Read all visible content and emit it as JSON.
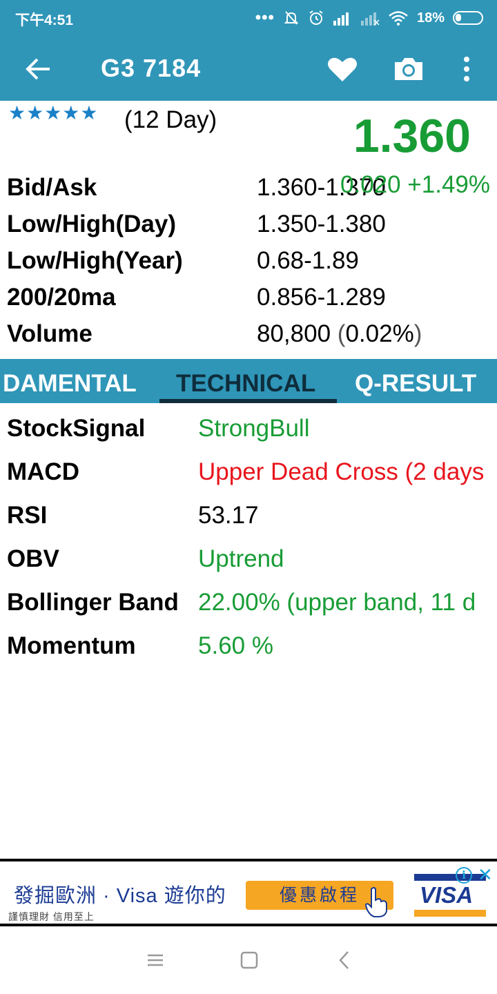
{
  "status_bar": {
    "time": "下午4:51",
    "dots": "•••",
    "battery_percent": "18%",
    "icons": [
      "mute-bell-icon",
      "alarm-icon",
      "signal-icon",
      "signal-no-service-icon",
      "wifi-icon",
      "battery-icon"
    ]
  },
  "app_bar": {
    "title": "G3 7184",
    "icons": [
      "back-arrow-icon",
      "heart-icon",
      "camera-icon",
      "more-vertical-icon"
    ],
    "color": "#2f96b8"
  },
  "rating": {
    "stars": "★★★★★",
    "star_count": 5,
    "period": "(12 Day)"
  },
  "quote": {
    "price": "1.360",
    "change": "0.020 +1.49%",
    "color": "#189c35"
  },
  "info": [
    {
      "label": "Bid/Ask",
      "value": "1.360-1.370"
    },
    {
      "label": "Low/High(Day)",
      "value": "1.350-1.380"
    },
    {
      "label": "Low/High(Year)",
      "value": "0.68-1.89"
    },
    {
      "label": "200/20ma",
      "value": "0.856-1.289"
    },
    {
      "label": "Volume",
      "value": "80,800",
      "pct_open": "(",
      "pct": "0.02%",
      "pct_close": ")"
    }
  ],
  "tabs": [
    {
      "label": "DAMENTAL",
      "active": false
    },
    {
      "label": "TECHNICAL",
      "active": true
    },
    {
      "label": "Q-RESULT",
      "active": false
    }
  ],
  "technical": [
    {
      "label": "StockSignal",
      "value": "StrongBull",
      "color": "#189c35"
    },
    {
      "label": "MACD",
      "value": "Upper Dead Cross (2 days",
      "color": "#e8141c"
    },
    {
      "label": "RSI",
      "value": "53.17",
      "color": "#000000"
    },
    {
      "label": "OBV",
      "value": "Uptrend",
      "color": "#189c35"
    },
    {
      "label": "Bollinger Band",
      "value": "22.00% (upper band, 11 d",
      "color": "#189c35"
    },
    {
      "label": "Momentum",
      "value": "5.60 %",
      "color": "#189c35"
    }
  ],
  "ad": {
    "headline": "發掘歐洲 · Visa 遊你的",
    "subtext": "謹慎理財 信用至上",
    "cta": "優惠啟程",
    "logo_text": "VISA",
    "icons": [
      "info-icon",
      "close-icon",
      "hand-pointer-icon"
    ]
  },
  "nav_bar": {
    "icons": [
      "menu-icon",
      "home-square-icon",
      "back-chevron-icon"
    ]
  }
}
